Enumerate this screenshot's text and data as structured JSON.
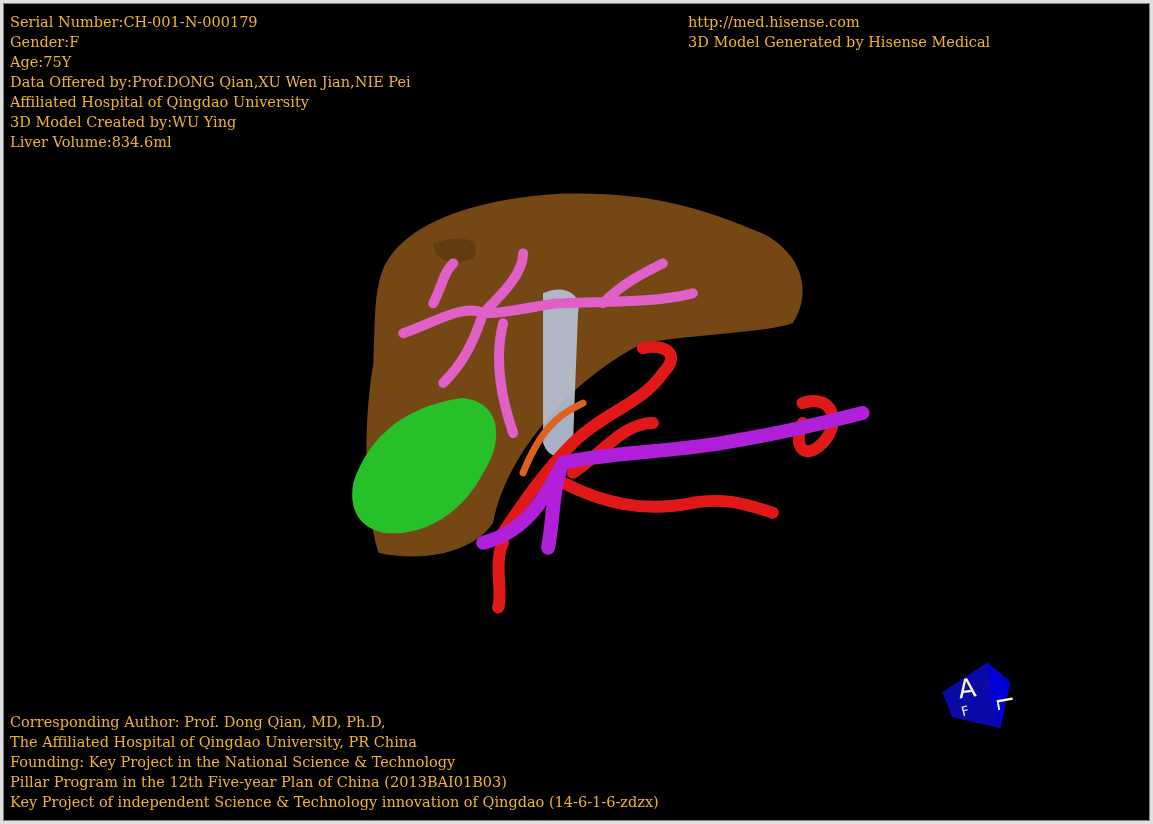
{
  "patient_info": [
    "Serial Number:CH-001-N-000179",
    "Gender:F",
    "Age:75Y",
    "Data Offered by:Prof.DONG Qian,XU Wen Jian,NIE Pei",
    "Affiliated Hospital of Qingdao University",
    "3D Model Created by:WU Ying",
    "Liver Volume:834.6ml"
  ],
  "source_info": [
    "http://med.hisense.com",
    "3D Model Generated by Hisense Medical"
  ],
  "credits": [
    "Corresponding Author: Prof. Dong Qian, MD, Ph.D,",
    "The Affiliated Hospital of Qingdao University, PR China",
    "Founding: Key Project in the National Science & Technology",
    "Pillar Program in the 12th Five-year Plan of China (2013BAI01B03)",
    "Key Project of independent Science & Technology innovation of Qingdao (14-6-1-6-zdzx)"
  ],
  "orientation_cube": {
    "labels": [
      "A",
      "L",
      "F"
    ]
  }
}
